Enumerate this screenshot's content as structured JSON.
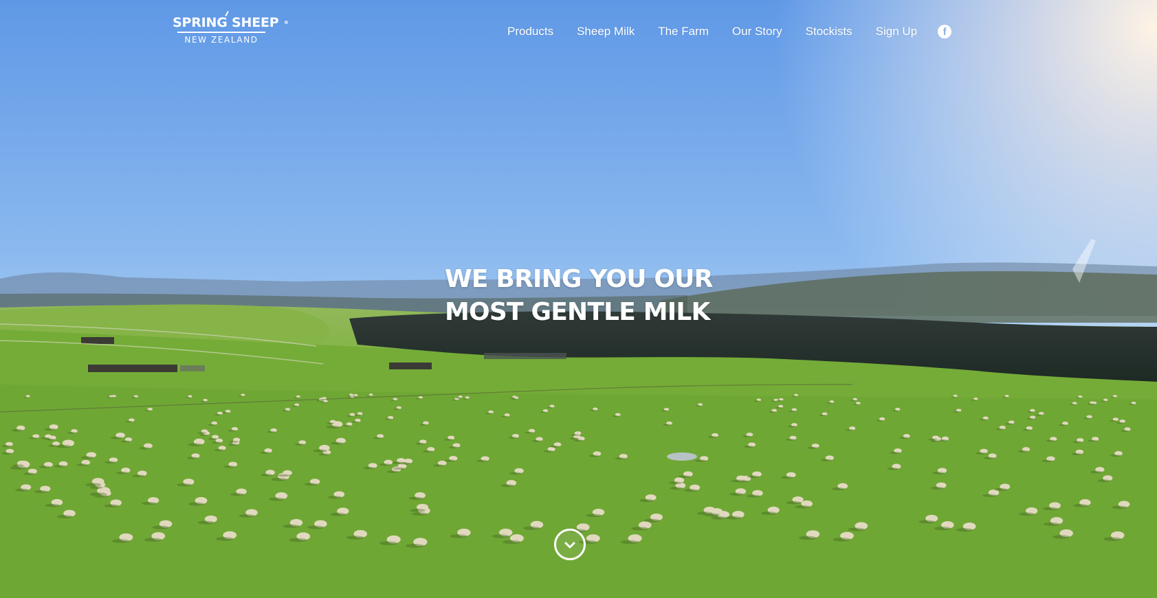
{
  "brand": {
    "logo_top": "SPRING SHEEP",
    "logo_mark": "®",
    "logo_bottom": "NEW ZEALAND"
  },
  "nav": {
    "items": [
      {
        "label": "Products"
      },
      {
        "label": "Sheep Milk"
      },
      {
        "label": "The Farm"
      },
      {
        "label": "Our Story"
      },
      {
        "label": "Stockists"
      },
      {
        "label": "Sign Up"
      }
    ],
    "social_icon": "facebook-icon",
    "social_glyph": "f"
  },
  "hero": {
    "headline_line_1": "WE BRING YOU OUR",
    "headline_line_2": "MOST GENTLE MILK",
    "scroll_icon": "chevron-down-icon"
  },
  "colors": {
    "sky_top": "#6ea2e6",
    "sky_horizon": "#f4eee2",
    "grass": "#79b33a",
    "nav_text": "#ffffff"
  }
}
